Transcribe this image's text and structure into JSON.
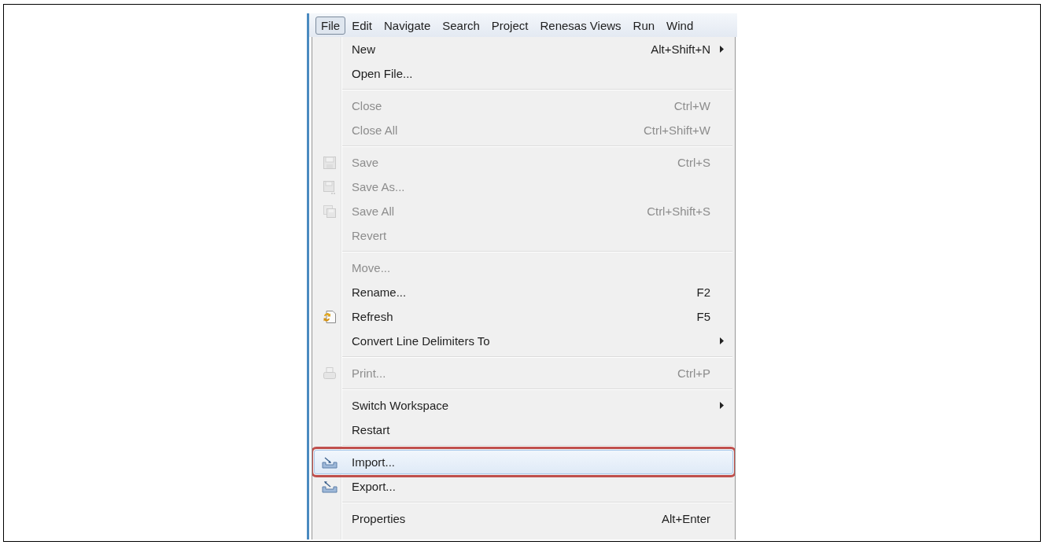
{
  "menu_bar": {
    "items": [
      {
        "label": "File",
        "selected": true
      },
      {
        "label": "Edit",
        "selected": false
      },
      {
        "label": "Navigate",
        "selected": false
      },
      {
        "label": "Search",
        "selected": false
      },
      {
        "label": "Project",
        "selected": false
      },
      {
        "label": "Renesas Views",
        "selected": false
      },
      {
        "label": "Run",
        "selected": false
      },
      {
        "label": "Wind",
        "selected": false
      }
    ]
  },
  "menu": {
    "groups": [
      {
        "items": [
          {
            "kind": "plain",
            "label": "New",
            "shortcut": "Alt+Shift+N",
            "disabled": false,
            "submenu": true,
            "selected": false
          },
          {
            "kind": "plain",
            "label": "Open File...",
            "disabled": false,
            "submenu": false,
            "selected": false
          }
        ]
      },
      {
        "items": [
          {
            "kind": "plain",
            "label": "Close",
            "shortcut": "Ctrl+W",
            "disabled": true,
            "submenu": false,
            "selected": false
          },
          {
            "kind": "plain",
            "label": "Close All",
            "shortcut": "Ctrl+Shift+W",
            "disabled": true,
            "submenu": false,
            "selected": false
          }
        ]
      },
      {
        "items": [
          {
            "kind": "save",
            "label": "Save",
            "shortcut": "Ctrl+S",
            "disabled": true,
            "submenu": false,
            "selected": false
          },
          {
            "kind": "saveas",
            "label": "Save As...",
            "disabled": true,
            "submenu": false,
            "selected": false
          },
          {
            "kind": "saveall",
            "label": "Save All",
            "shortcut": "Ctrl+Shift+S",
            "disabled": true,
            "submenu": false,
            "selected": false
          },
          {
            "kind": "plain",
            "label": "Revert",
            "disabled": true,
            "submenu": false,
            "selected": false
          }
        ]
      },
      {
        "items": [
          {
            "kind": "plain",
            "label": "Move...",
            "disabled": true,
            "submenu": false,
            "selected": false
          },
          {
            "kind": "plain",
            "label": "Rename...",
            "shortcut": "F2",
            "disabled": false,
            "submenu": false,
            "selected": false
          },
          {
            "kind": "refresh",
            "label": "Refresh",
            "shortcut": "F5",
            "disabled": false,
            "submenu": false,
            "selected": false
          },
          {
            "kind": "plain",
            "label": "Convert Line Delimiters To",
            "disabled": false,
            "submenu": true,
            "selected": false
          }
        ]
      },
      {
        "items": [
          {
            "kind": "print",
            "label": "Print...",
            "shortcut": "Ctrl+P",
            "disabled": true,
            "submenu": false,
            "selected": false
          }
        ]
      },
      {
        "items": [
          {
            "kind": "plain",
            "label": "Switch Workspace",
            "disabled": false,
            "submenu": true,
            "selected": false
          },
          {
            "kind": "plain",
            "label": "Restart",
            "disabled": false,
            "submenu": false,
            "selected": false
          }
        ]
      },
      {
        "items": [
          {
            "kind": "import",
            "label": "Import...",
            "disabled": false,
            "submenu": false,
            "selected": true
          },
          {
            "kind": "export",
            "label": "Export...",
            "disabled": false,
            "submenu": false,
            "selected": false
          }
        ]
      },
      {
        "items": [
          {
            "kind": "plain",
            "label": "Properties",
            "shortcut": "Alt+Enter",
            "disabled": false,
            "submenu": false,
            "selected": false
          }
        ]
      }
    ]
  }
}
